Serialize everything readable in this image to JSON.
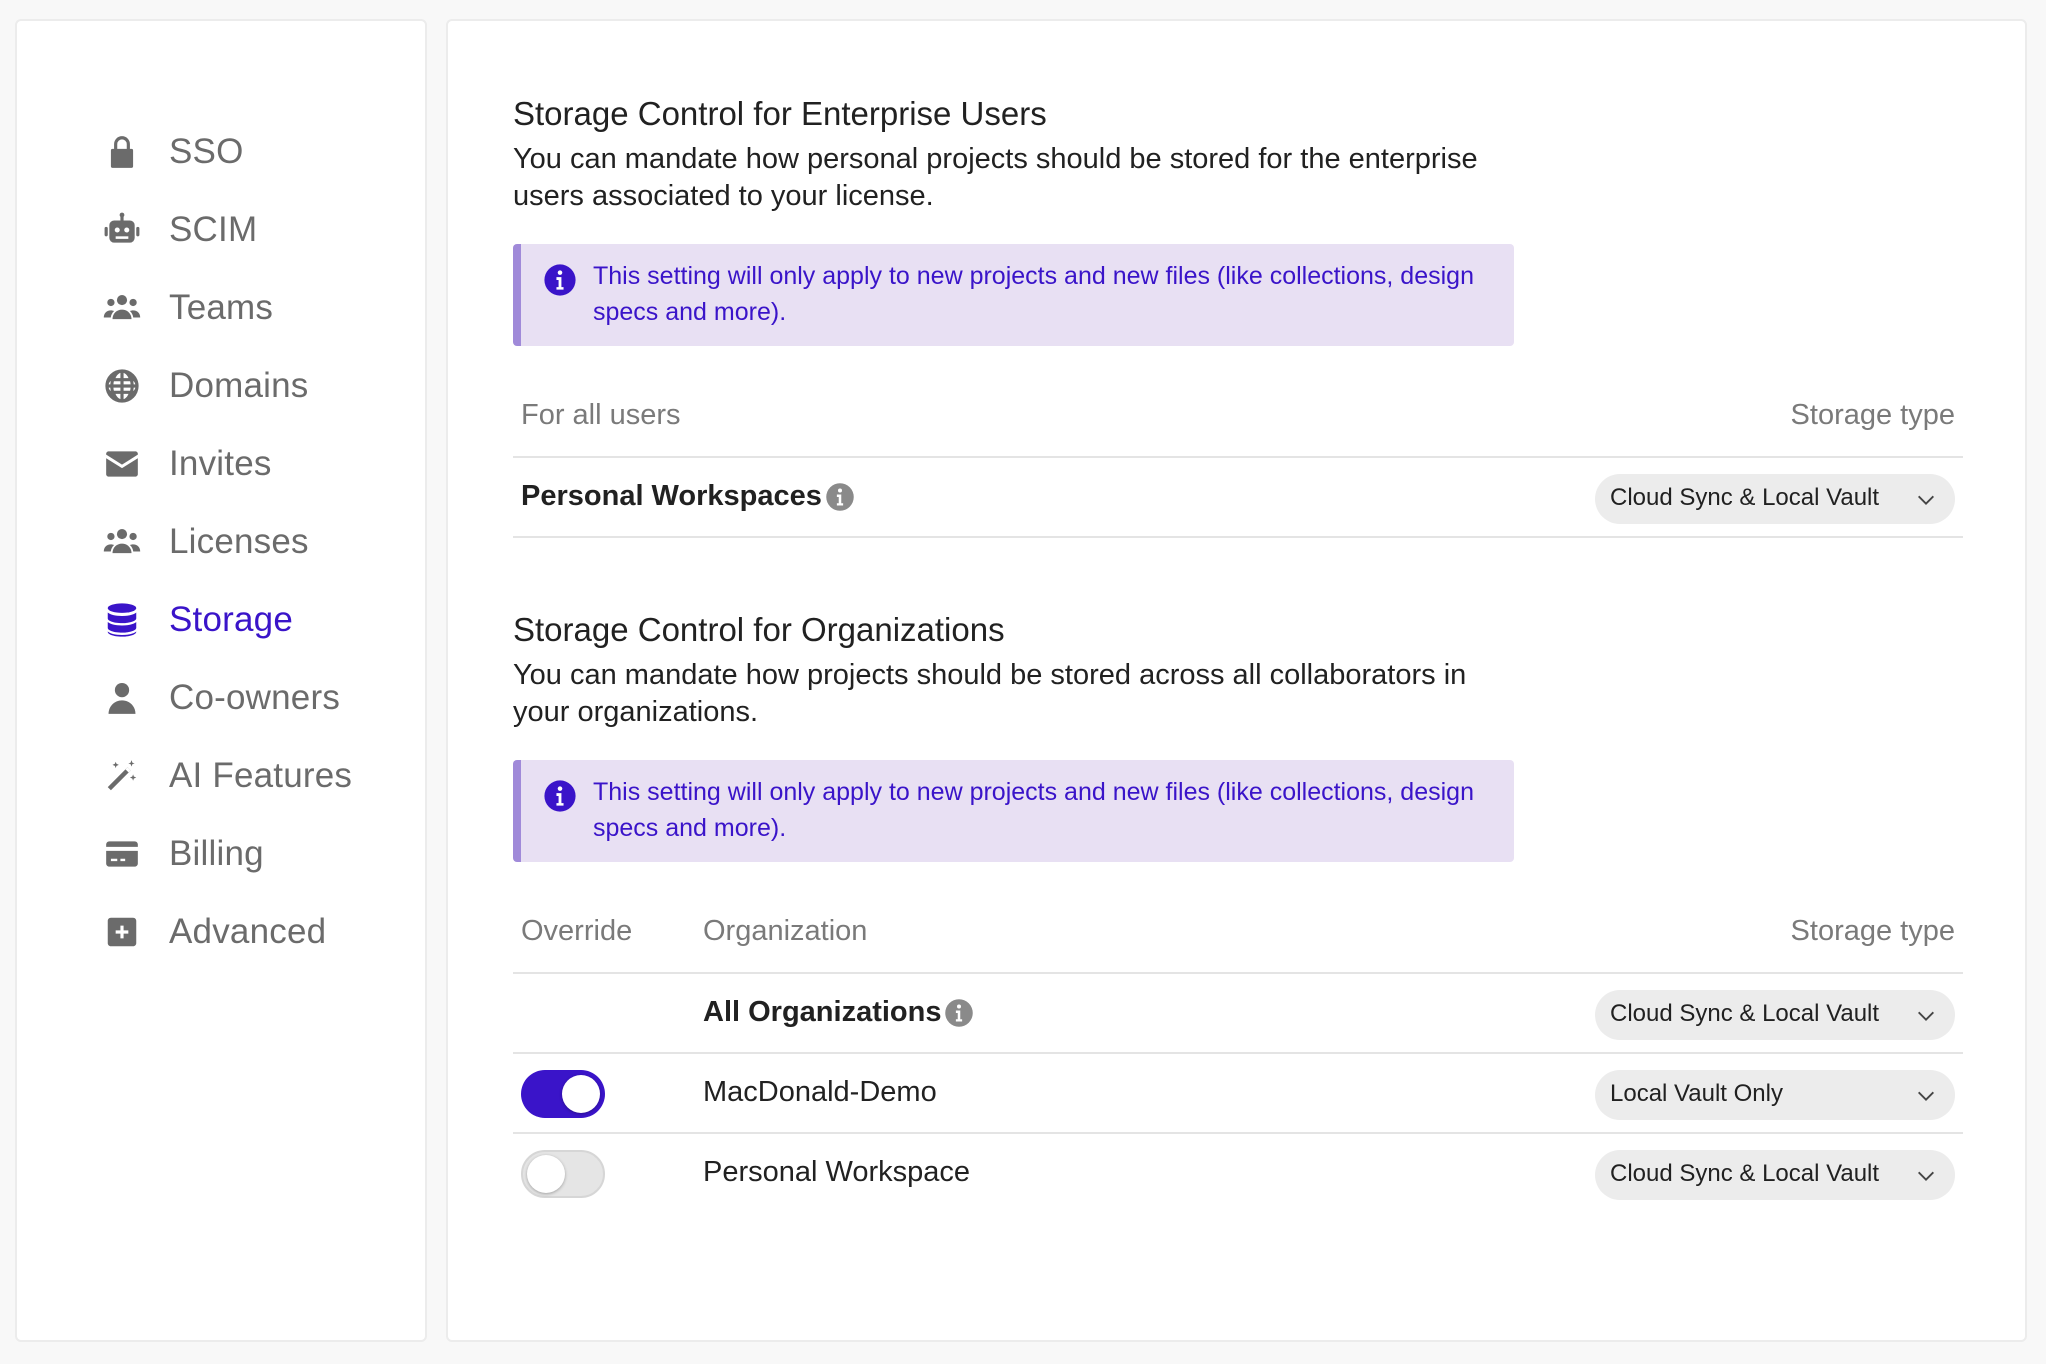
{
  "sidebar": {
    "items": [
      {
        "label": "SSO",
        "icon": "lock-icon"
      },
      {
        "label": "SCIM",
        "icon": "robot-icon"
      },
      {
        "label": "Teams",
        "icon": "users-icon"
      },
      {
        "label": "Domains",
        "icon": "globe-icon"
      },
      {
        "label": "Invites",
        "icon": "envelope-icon"
      },
      {
        "label": "Licenses",
        "icon": "users-icon"
      },
      {
        "label": "Storage",
        "icon": "database-icon",
        "active": true
      },
      {
        "label": "Co-owners",
        "icon": "user-icon"
      },
      {
        "label": "AI Features",
        "icon": "magic-wand-icon"
      },
      {
        "label": "Billing",
        "icon": "credit-card-icon"
      },
      {
        "label": "Advanced",
        "icon": "plus-square-icon"
      }
    ]
  },
  "enterprise": {
    "title": "Storage Control for Enterprise Users",
    "description": "You can mandate how personal projects should be stored for the enterprise users associated to your license.",
    "banner": "This setting will only apply to new projects and new files (like collections, design specs and more).",
    "header_left": "For all users",
    "header_right": "Storage type",
    "row_label": "Personal Workspaces",
    "row_value": "Cloud Sync & Local Vault"
  },
  "organizations": {
    "title": "Storage Control for Organizations",
    "description": "You can mandate how projects should be stored across all collaborators in your organizations.",
    "banner": "This setting will only apply to new projects and new files (like collections, design specs and more).",
    "header_override": "Override",
    "header_org": "Organization",
    "header_storage": "Storage type",
    "rows": [
      {
        "name": "All Organizations",
        "value": "Cloud Sync & Local Vault"
      },
      {
        "name": "MacDonald-Demo",
        "value": "Local Vault Only",
        "override": true
      },
      {
        "name": "Personal Workspace",
        "value": "Cloud Sync & Local Vault",
        "override": false
      }
    ]
  },
  "colors": {
    "accent": "#3a14c9",
    "banner_bg": "#e8e0f3",
    "muted_text": "#6b6b6b"
  }
}
